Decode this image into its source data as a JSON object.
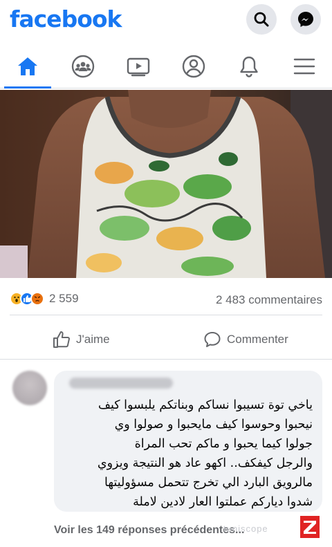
{
  "header": {
    "logo": "facebook",
    "logo_color": "#1877f2"
  },
  "nav": {
    "items": [
      {
        "name": "home-icon",
        "active": true
      },
      {
        "name": "groups-icon",
        "active": false
      },
      {
        "name": "watch-icon",
        "active": false
      },
      {
        "name": "profile-icon",
        "active": false
      },
      {
        "name": "notifications-icon",
        "active": false
      },
      {
        "name": "menu-icon",
        "active": false
      }
    ]
  },
  "post": {
    "reaction_icons": [
      "wow-reaction-icon",
      "like-reaction-icon",
      "angry-reaction-icon"
    ],
    "reactions_count": "2 559",
    "comments_count": "2 483 commentaires",
    "like_label": "J'aime",
    "comment_label": "Commenter"
  },
  "comment": {
    "lines": [
      "ياخي توة تسيبوا نساكم وبناتكم يلبسوا كيف",
      "نيحبوا وحوسوا كيف مايحبوا و صولوا وي",
      "جولوا كيما يحبوا و ماكم تحب المراة",
      "والرجل كيفكف.. اكهو عاد هو النتيجة ويزوي",
      "مالرويق البارد الي تخرج تتحمل مسؤوليتها",
      "شدوا ديارکم عملتوا العار لادين لاملة"
    ]
  },
  "footer": {
    "more_replies": "Voir les 149 réponses précédentes...",
    "watermark": "tuniscope"
  }
}
